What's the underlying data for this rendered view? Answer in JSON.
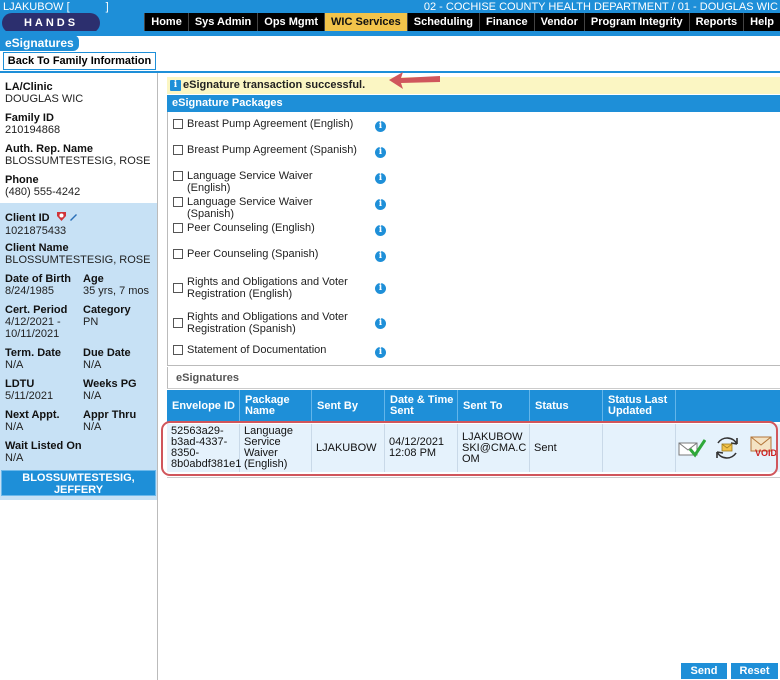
{
  "header": {
    "user": "LJAKUBOW [",
    "user_suffix": "]",
    "department": "02 - COCHISE COUNTY HEALTH DEPARTMENT / 01 - DOUGLAS WIC",
    "logo_text": "HANDS"
  },
  "nav": {
    "items": [
      "Home",
      "Sys Admin",
      "Ops Mgmt",
      "WIC Services",
      "Scheduling",
      "Finance",
      "Vendor",
      "Program Integrity",
      "Reports",
      "Help"
    ],
    "active": "WIC Services"
  },
  "page": {
    "title": "eSignatures",
    "back_button": "Back To Family Information"
  },
  "family": {
    "la_clinic_label": "LA/Clinic",
    "la_clinic_value": "DOUGLAS WIC",
    "family_id_label": "Family ID",
    "family_id_value": "210194868",
    "auth_rep_label": "Auth. Rep. Name",
    "auth_rep_value": "BLOSSUMTESTESIG, ROSE",
    "phone_label": "Phone",
    "phone_value": "(480) 555-4242"
  },
  "client": {
    "client_id_label": "Client ID",
    "client_id_value": "1021875433",
    "client_name_label": "Client Name",
    "client_name_value": "BLOSSUMTESTESIG, ROSE",
    "dob_label": "Date of Birth",
    "dob_value": "8/24/1985",
    "age_label": "Age",
    "age_value": "35 yrs, 7 mos",
    "cert_label": "Cert. Period",
    "cert_value_1": "4/12/2021 -",
    "cert_value_2": "10/11/2021",
    "category_label": "Category",
    "category_value": "PN",
    "term_label": "Term. Date",
    "term_value": "N/A",
    "due_label": "Due Date",
    "due_value": "N/A",
    "ldtu_label": "LDTU",
    "ldtu_value": "5/11/2021",
    "weeks_label": "Weeks PG",
    "weeks_value": "N/A",
    "next_appt_label": "Next Appt.",
    "next_appt_value": "N/A",
    "appr_thru_label": "Appr Thru",
    "appr_thru_value": "N/A",
    "wait_label": "Wait Listed On",
    "wait_value": "N/A",
    "member_button_1": "BLOSSUMTESTESIG,",
    "member_button_2": "JEFFERY"
  },
  "message": {
    "success": "eSignature transaction successful.",
    "info_glyph": "i"
  },
  "packages": {
    "header": "eSignature Packages",
    "items": [
      {
        "line1": "Breast Pump Agreement (English)",
        "line2": ""
      },
      {
        "line1": "Breast Pump Agreement (Spanish)",
        "line2": ""
      },
      {
        "line1": "Language Service Waiver (English)",
        "line2": ""
      },
      {
        "line1": "Language Service Waiver (Spanish)",
        "line2": ""
      },
      {
        "line1": "Peer Counseling (English)",
        "line2": ""
      },
      {
        "line1": "Peer Counseling (Spanish)",
        "line2": ""
      },
      {
        "line1": "Rights and Obligations and Voter",
        "line2": "Registration (English)"
      },
      {
        "line1": "Rights and Obligations and Voter",
        "line2": "Registration (Spanish)"
      },
      {
        "line1": "Statement of Documentation",
        "line2": ""
      }
    ]
  },
  "esignatures": {
    "title": "eSignatures",
    "columns": [
      "Envelope ID",
      "Package Name",
      "Sent By",
      "Date & Time Sent",
      "Sent To",
      "Status",
      "Status Last Updated"
    ],
    "rows": [
      {
        "envelope_id": "52563a29-b3ad-4337-8350-8b0abdf381e1",
        "package_name": "Language Service Waiver (English)",
        "sent_by": "LJAKUBOW",
        "date_time": "04/12/2021 12:08 PM",
        "sent_to": "LJAKUBOWSKI@CMA.COM",
        "status": "Sent",
        "status_last_updated": "",
        "void_label": "VOID"
      }
    ]
  },
  "footer": {
    "send": "Send",
    "reset": "Reset"
  },
  "colors": {
    "primary": "#1e8fd8",
    "active_nav": "#f2c34a",
    "success_bg": "#fbf6c3",
    "annotation": "#d0565c"
  }
}
